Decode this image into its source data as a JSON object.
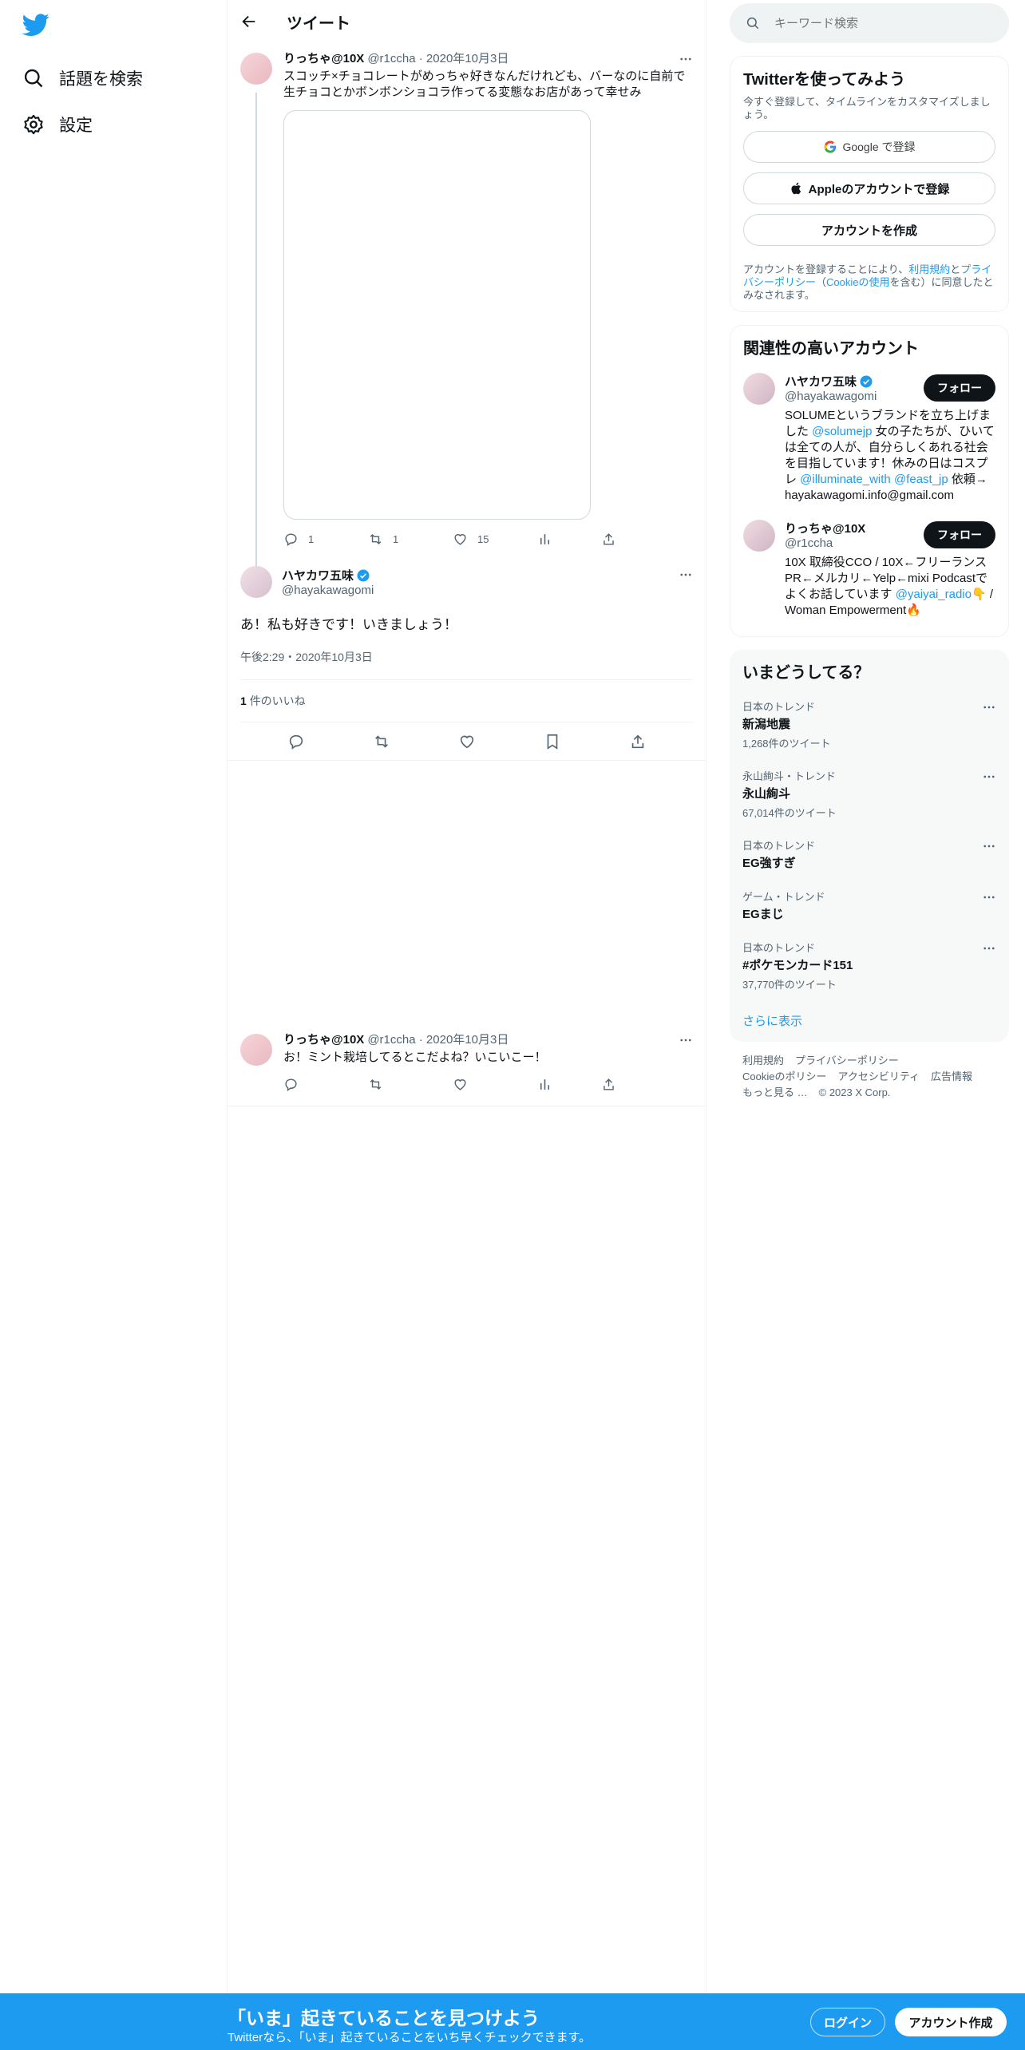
{
  "nav": {
    "items": [
      {
        "label": "話題を検索",
        "icon": "search-icon"
      },
      {
        "label": "設定",
        "icon": "gear-icon"
      }
    ]
  },
  "header": {
    "title": "ツイート"
  },
  "thread_tweet": {
    "name": "りっちゃ@10X",
    "handle": "@r1ccha",
    "date": "2020年10月3日",
    "text": "スコッチ×チョコレートがめっちゃ好きなんだけれども、バーなのに自前で生チョコとかボンボンショコラ作ってる変態なお店があって幸せみ",
    "replies": "1",
    "retweets": "1",
    "likes": "15"
  },
  "focus_tweet": {
    "name": "ハヤカワ五味",
    "handle": "@hayakawagomi",
    "text": "あ！私も好きです！いきましょう！",
    "time": "午後2:29・2020年10月3日",
    "likes_count": "1",
    "likes_label": "件のいいね"
  },
  "reply_tweet": {
    "name": "りっちゃ@10X",
    "handle": "@r1ccha",
    "date": "2020年10月3日",
    "text": "お！ミント栽培してるとこだよね？いこいこー！"
  },
  "search": {
    "placeholder": "キーワード検索"
  },
  "signup_card": {
    "title": "Twitterを使ってみよう",
    "subtitle": "今すぐ登録して、タイムラインをカスタマイズしましょう。",
    "google": "Google で登録",
    "apple": "Appleのアカウントで登録",
    "create": "アカウントを作成",
    "legal_1": "アカウントを登録することにより、",
    "legal_terms": "利用規約",
    "legal_2": "と",
    "legal_privacy": "プライバシーポリシー",
    "legal_3": "（",
    "legal_cookie": "Cookieの使用",
    "legal_4": "を含む）に同意したとみなされます。"
  },
  "relevant": {
    "title": "関連性の高いアカウント",
    "accounts": [
      {
        "name": "ハヤカワ五味",
        "handle": "@hayakawagomi",
        "follow": "フォロー",
        "bio_1": "SOLUMEというブランドを立ち上げました ",
        "bio_m1": "@solumejp",
        "bio_2": " 女の子たちが、ひいては全ての人が、自分らしくあれる社会を目指しています！休みの日はコスプレ ",
        "bio_m2": "@illuminate_with",
        "bio_3": " ",
        "bio_m3": "@feast_jp",
        "bio_4": " 依頼→ hayakawagomi.info@gmail.com"
      },
      {
        "name": "りっちゃ@10X",
        "handle": "@r1ccha",
        "follow": "フォロー",
        "bio_1": "10X 取締役CCO / 10X←フリーランスPR←メルカリ←Yelp←mixi Podcastでよくお話しています ",
        "bio_m1": "@yaiyai_radio",
        "bio_2": "👇 / Woman Empowerment🔥"
      }
    ]
  },
  "trends": {
    "title": "いまどうしてる？",
    "items": [
      {
        "context": "日本のトレンド",
        "name": "新潟地震",
        "count": "1,268件のツイート"
      },
      {
        "context": "永山絢斗・トレンド",
        "name": "永山絢斗",
        "count": "67,014件のツイート"
      },
      {
        "context": "日本のトレンド",
        "name": "EG強すぎ",
        "count": ""
      },
      {
        "context": "ゲーム・トレンド",
        "name": "EGまじ",
        "count": ""
      },
      {
        "context": "日本のトレンド",
        "name": "#ポケモンカード151",
        "count": "37,770件のツイート"
      }
    ],
    "show_more": "さらに表示"
  },
  "footer": {
    "links": [
      "利用規約",
      "プライバシーポリシー",
      "Cookieのポリシー",
      "アクセシビリティ",
      "広告情報",
      "もっと見る …"
    ],
    "copyright": "© 2023 X Corp."
  },
  "bottom_bar": {
    "title": "「いま」起きていることを見つけよう",
    "subtitle": "Twitterなら、「いま」起きていることをいち早くチェックできます。",
    "login": "ログイン",
    "signup": "アカウント作成"
  },
  "colors": {
    "accent": "#1d9bf0",
    "text": "#0f1419",
    "muted": "#536471"
  }
}
